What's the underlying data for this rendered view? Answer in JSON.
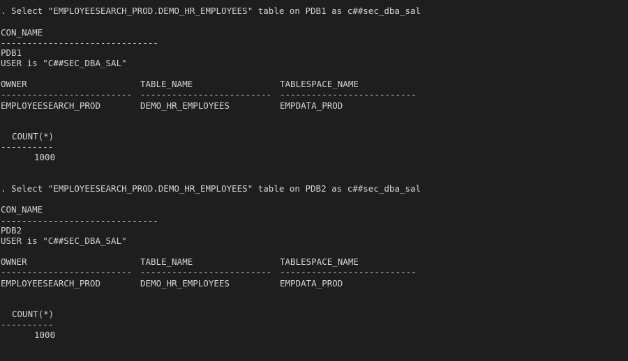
{
  "terminal": {
    "sections": [
      {
        "select_line": ". Select \"EMPLOYEESEARCH_PROD.DEMO_HR_EMPLOYEES\" table on PDB1 as c##sec_dba_sal",
        "con_name_header": "CON_NAME",
        "con_name_rule": "------------------------------",
        "con_name_value": "PDB1",
        "user_line": "USER is \"C##SEC_DBA_SAL\"",
        "table_headers": [
          "OWNER",
          "TABLE_NAME",
          "TABLESPACE_NAME"
        ],
        "table_rules": [
          "-------------------------",
          "-------------------------",
          "--------------------------"
        ],
        "table_row": [
          "EMPLOYEESEARCH_PROD",
          "DEMO_HR_EMPLOYEES",
          "EMPDATA_PROD"
        ],
        "count_header": "COUNT(*)",
        "count_rule": "----------",
        "count_value": "1000"
      },
      {
        "select_line": ". Select \"EMPLOYEESEARCH_PROD.DEMO_HR_EMPLOYEES\" table on PDB2 as c##sec_dba_sal",
        "con_name_header": "CON_NAME",
        "con_name_rule": "------------------------------",
        "con_name_value": "PDB2",
        "user_line": "USER is \"C##SEC_DBA_SAL\"",
        "table_headers": [
          "OWNER",
          "TABLE_NAME",
          "TABLESPACE_NAME"
        ],
        "table_rules": [
          "-------------------------",
          "-------------------------",
          "--------------------------"
        ],
        "table_row": [
          "EMPLOYEESEARCH_PROD",
          "DEMO_HR_EMPLOYEES",
          "EMPDATA_PROD"
        ],
        "count_header": "COUNT(*)",
        "count_rule": "----------",
        "count_value": "1000"
      }
    ]
  },
  "colors": {
    "background": "#1e1e1e",
    "text": "#d4d4d4"
  }
}
